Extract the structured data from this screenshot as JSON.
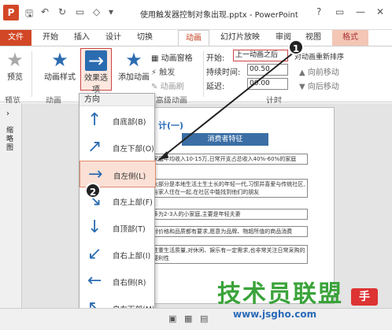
{
  "window": {
    "title": "使用触发器控制对象出现.pptx - PowerPoint",
    "app_icon": "P",
    "help": "?",
    "restore": "▭",
    "minimize": "—",
    "close": "✕"
  },
  "tabs": [
    "文件",
    "开始",
    "插入",
    "设计",
    "切换",
    "动画",
    "幻灯片放映",
    "审阅",
    "视图",
    "格式"
  ],
  "ribbon": {
    "preview": "预览",
    "anim_style": "动画样式",
    "effect_options": "效果选项",
    "add_anim": "添加动画",
    "anim_pane": "动画窗格",
    "trigger": "触发",
    "anim_painter": "动画刷",
    "start_label": "开始:",
    "start_value": "上一动画之后",
    "duration_label": "持续时间:",
    "duration_value": "00.50",
    "delay_label": "延迟:",
    "delay_value": "00.00",
    "reorder": "对动画重新排序",
    "move_earlier": "向前移动",
    "move_later": "向后移动",
    "grp_preview": "预览",
    "grp_anim": "动画",
    "grp_adv": "高级动画",
    "grp_timing": "计时"
  },
  "dropdown": {
    "header": "方向",
    "items": [
      "自底部(B)",
      "自左下部(O)",
      "自左侧(L)",
      "自左上部(F)",
      "自顶部(T)",
      "自右上部(I)",
      "自右侧(R)",
      "自右下部(M)"
    ],
    "selected": 2,
    "arrows": [
      "↑",
      "↗",
      "→",
      "↘",
      "↓",
      "↙",
      "←",
      "↖"
    ]
  },
  "slide": {
    "heading_partial": "计(一)",
    "box_title": "消费者特征",
    "lines": [
      "家庭年均收入10-15万,日常开支占总收入40%-60%的家庭",
      "大部分是本地生活土生土长的年轻一代,习惯并喜爱与传统社区,与家人住在一起,在社区中能找到他们的朋友",
      "多为2-3人的小家庭,主要是年轻夫妻",
      "对价格和品质都有要求,愿意为品牌、物超所值的商品消费",
      "注重生活质量,对休闲、娱乐有一定需求,也非常关注日常采购的便利性"
    ]
  },
  "left_panel_label": "缩略图",
  "callouts": [
    "1",
    "2"
  ],
  "watermark": {
    "text": "技术员联盟",
    "url": "www.jsgho.com",
    "tag": "手"
  }
}
